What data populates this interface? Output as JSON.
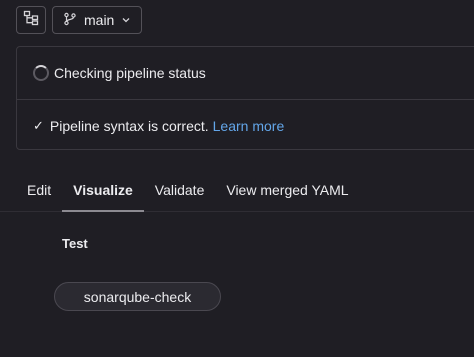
{
  "toolbar": {
    "pipeline_icon": "pipeline-tree-icon",
    "branch_icon": "git-branch-icon",
    "branch": "main",
    "chevron_icon": "chevron-down-icon"
  },
  "status": {
    "checking_text": "Checking pipeline status",
    "syntax_text": "Pipeline syntax is correct.",
    "learn_more": "Learn more"
  },
  "tabs": [
    {
      "label": "Edit",
      "active": false
    },
    {
      "label": "Visualize",
      "active": true
    },
    {
      "label": "Validate",
      "active": false
    },
    {
      "label": "View merged YAML",
      "active": false
    }
  ],
  "graph": {
    "stage": "Test",
    "job": "sonarqube-check"
  },
  "colors": {
    "background": "#1f1e24",
    "link": "#63a6e9",
    "text": "#ececef"
  }
}
